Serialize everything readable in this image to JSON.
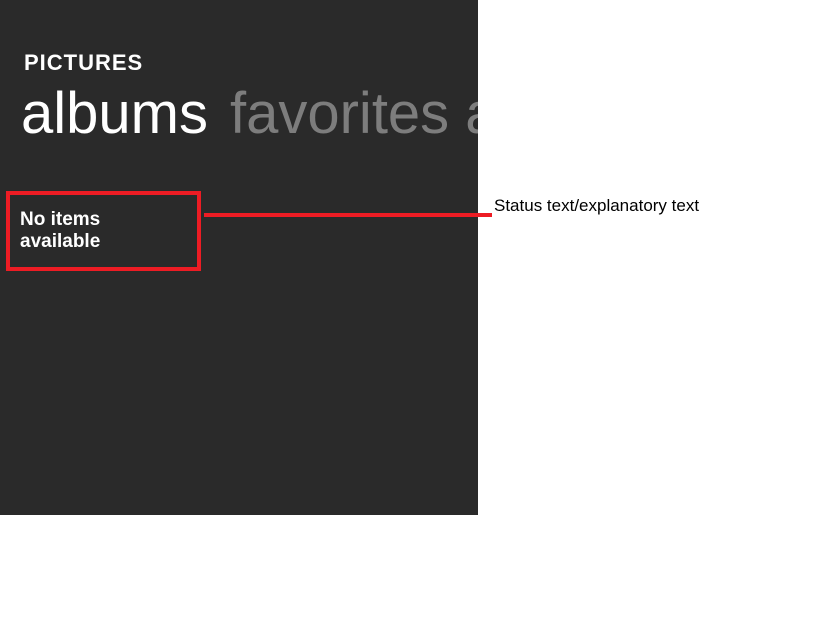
{
  "colors": {
    "panel_bg": "#2a2a2a",
    "accent_red": "#ed1c24",
    "text_active": "#ffffff",
    "text_inactive": "#7d7d7d"
  },
  "hub": {
    "title": "PICTURES",
    "pivots": {
      "active": "albums",
      "next": "favorites al"
    },
    "status": "No items available"
  },
  "annotation": {
    "label": "Status text/explanatory text"
  }
}
